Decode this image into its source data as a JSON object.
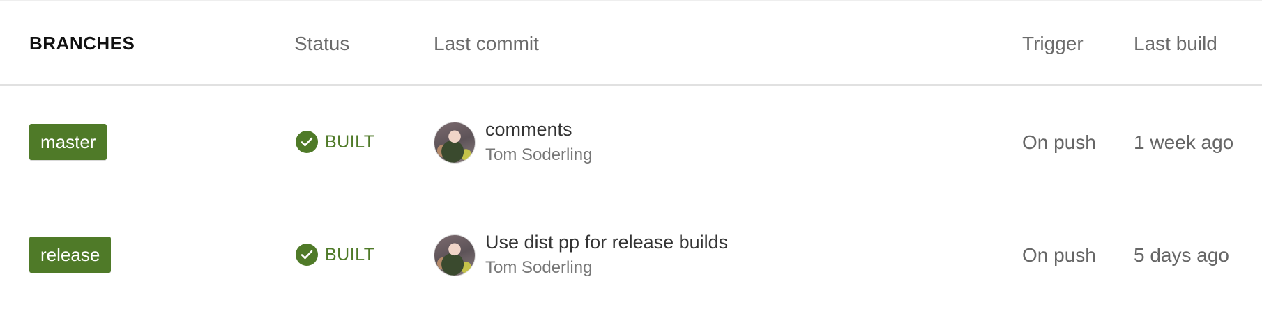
{
  "header": {
    "branches": "BRANCHES",
    "status": "Status",
    "last_commit": "Last commit",
    "trigger": "Trigger",
    "last_build": "Last build"
  },
  "rows": [
    {
      "branch": "master",
      "status": "BUILT",
      "commit_message": "comments",
      "commit_author": "Tom Soderling",
      "trigger": "On push",
      "last_build": "1 week ago"
    },
    {
      "branch": "release",
      "status": "BUILT",
      "commit_message": "Use dist pp for release builds",
      "commit_author": "Tom Soderling",
      "trigger": "On push",
      "last_build": "5 days ago"
    }
  ],
  "colors": {
    "branch_pill": "#4f7a28",
    "status_built": "#4f7a28"
  },
  "icons": {
    "status": "check-circle-icon",
    "author": "avatar"
  }
}
